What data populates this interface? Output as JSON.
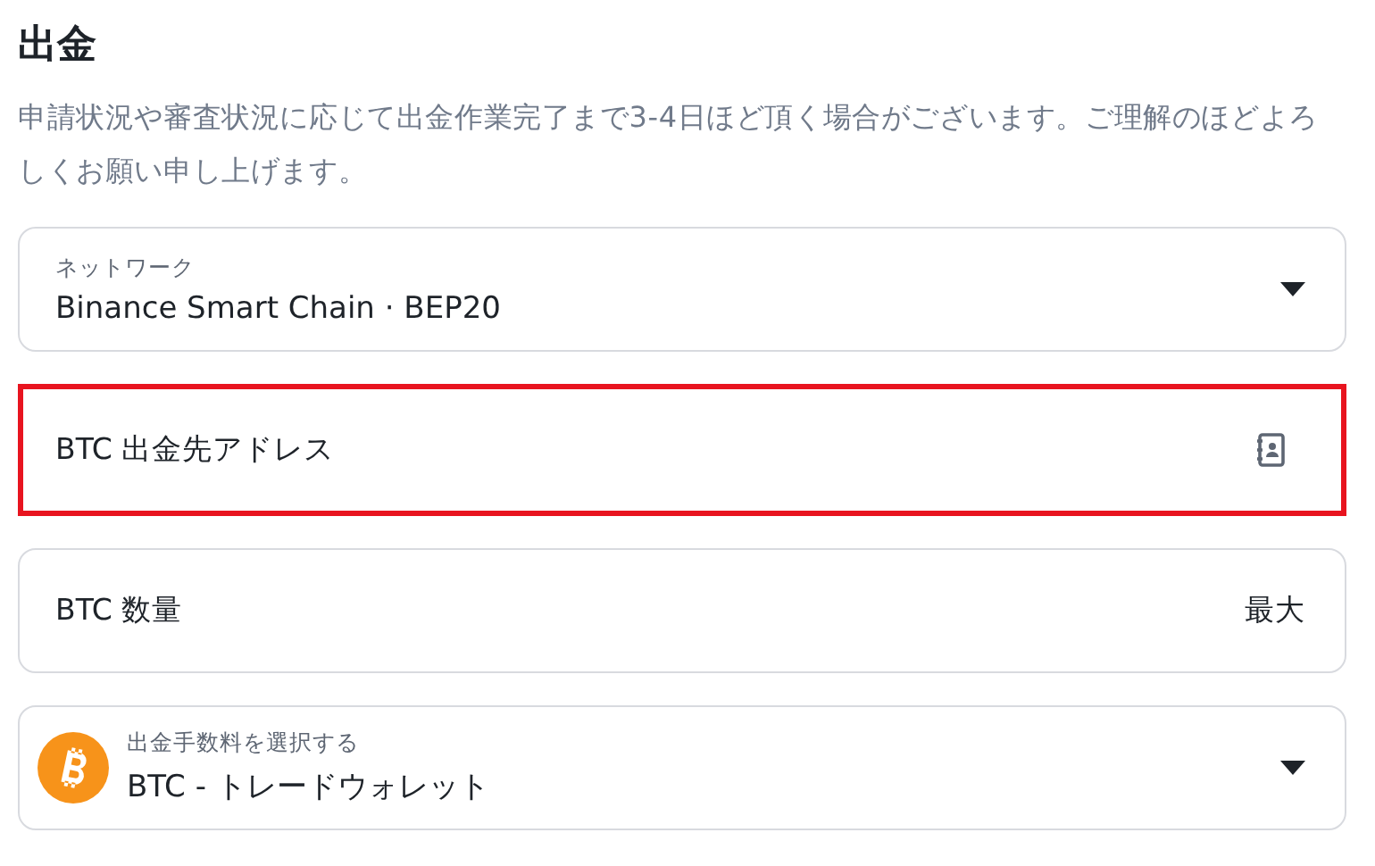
{
  "title": "出金",
  "description": "申請状況や審査状況に応じて出金作業完了まで3-4日ほど頂く場合がございます。ご理解のほどよろしくお願い申し上げます。",
  "fields": [
    {
      "kind": "select",
      "label": "ネットワーク",
      "value": "Binance Smart Chain · BEP20",
      "highlighted": false
    },
    {
      "kind": "input",
      "placeholder": "BTC 出金先アドレス",
      "action": {
        "kind": "icon"
      },
      "highlighted": true
    },
    {
      "kind": "input",
      "placeholder": "BTC 数量",
      "action": {
        "kind": "text",
        "label": "最大"
      },
      "highlighted": false
    },
    {
      "kind": "select",
      "label": "出金手数料を選択する",
      "value": "BTC - トレードウォレット",
      "coin_icon": true,
      "highlighted": false
    }
  ]
}
